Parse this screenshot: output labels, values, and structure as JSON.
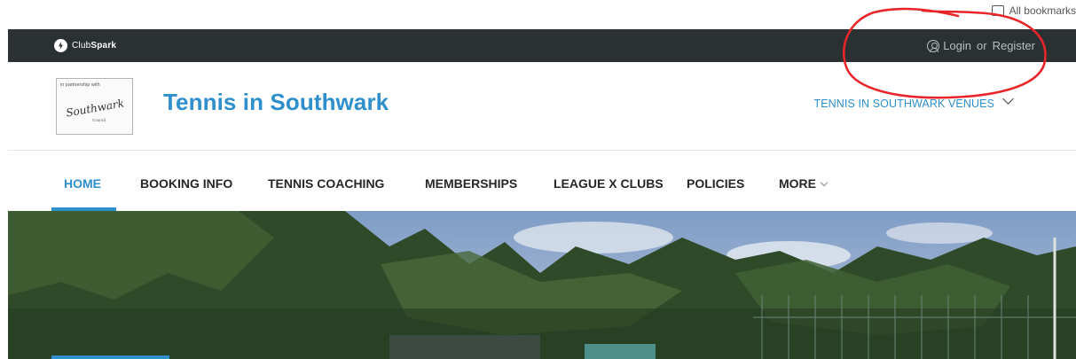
{
  "bookmarks": {
    "all_bookmarks_label": "All bookmarks"
  },
  "topbar": {
    "brand_light": "Club",
    "brand_bold": "Spark",
    "login_label": "Login",
    "or_label": "or",
    "register_label": "Register"
  },
  "header": {
    "partner_caption": "in partnership with",
    "partner_name": "Southwark",
    "partner_sub": "Council",
    "site_title": "Tennis in Southwark",
    "venues_label": "TENNIS IN SOUTHWARK VENUES"
  },
  "nav": {
    "items": [
      {
        "label": "HOME",
        "active": true
      },
      {
        "label": "BOOKING INFO"
      },
      {
        "label": "TENNIS COACHING"
      },
      {
        "label": "MEMBERSHIPS"
      },
      {
        "label": "LEAGUE X CLUBS"
      },
      {
        "label": "POLICIES"
      },
      {
        "label": "MORE"
      }
    ]
  },
  "colors": {
    "accent": "#2e8fcc",
    "topbar_bg": "#2b3032",
    "annotation": "#e8262a"
  },
  "icons": {
    "brand": "clubspark-logo-icon",
    "user": "user-circle-icon",
    "venues_dropdown": "chevron-down-icon",
    "more_dropdown": "chevron-down-icon",
    "bookmarks": "folder-icon"
  }
}
